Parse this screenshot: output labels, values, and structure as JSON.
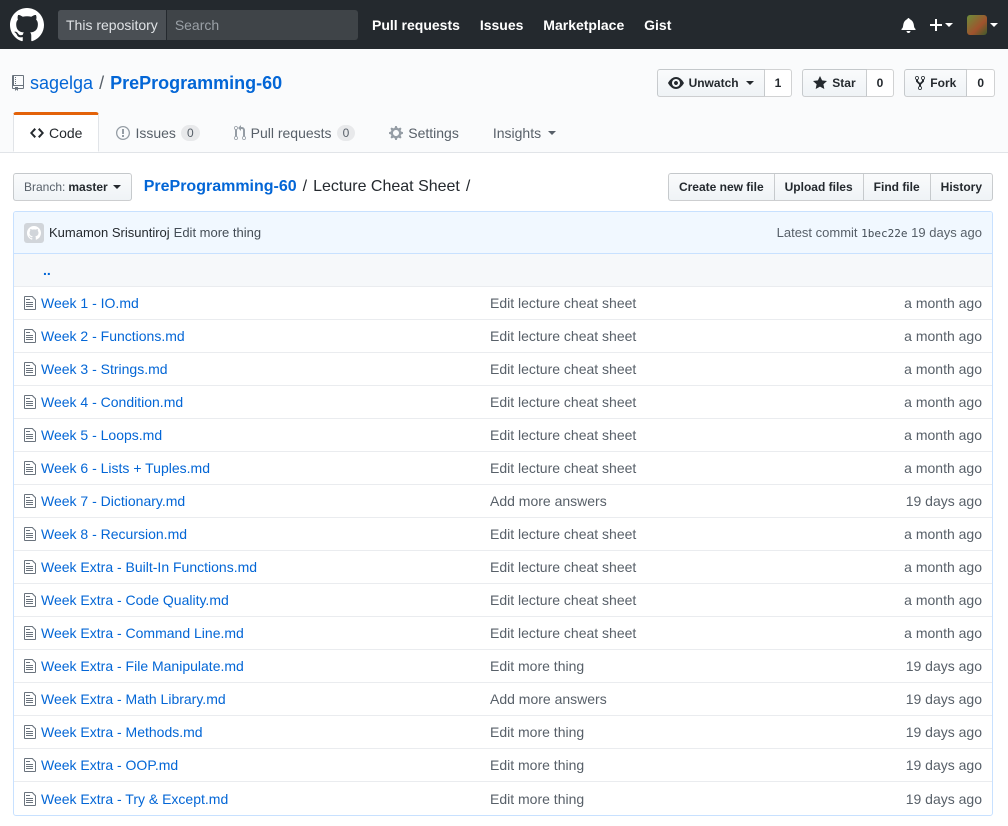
{
  "header": {
    "search_scope": "This repository",
    "search_placeholder": "Search",
    "nav": [
      "Pull requests",
      "Issues",
      "Marketplace",
      "Gist"
    ],
    "icons": [
      "github-logo-icon",
      "bell-icon",
      "plus-icon",
      "avatar"
    ]
  },
  "repo": {
    "owner": "sagelga",
    "separator": "/",
    "name": "PreProgramming-60",
    "watch_label": "Unwatch",
    "watch_count": "1",
    "star_label": "Star",
    "star_count": "0",
    "fork_label": "Fork",
    "fork_count": "0"
  },
  "tabs": [
    {
      "label": "Code",
      "counter": null,
      "icon": "code-icon"
    },
    {
      "label": "Issues",
      "counter": "0",
      "icon": "issue-icon"
    },
    {
      "label": "Pull requests",
      "counter": "0",
      "icon": "pr-icon"
    },
    {
      "label": "Settings",
      "counter": null,
      "icon": "gear-icon"
    },
    {
      "label": "Insights",
      "counter": null,
      "icon": null
    }
  ],
  "file_nav": {
    "branch_prefix": "Branch:",
    "branch": "master",
    "breadcrumb_root": "PreProgramming-60",
    "breadcrumb_sep": "/",
    "breadcrumb_current": "Lecture Cheat Sheet",
    "breadcrumb_trailing": "/",
    "actions": [
      "Create new file",
      "Upload files",
      "Find file",
      "History"
    ]
  },
  "commit": {
    "author": "Kumamon Srisuntiroj",
    "message": "Edit more thing",
    "latest_label": "Latest commit",
    "sha": "1bec22e",
    "age": "19 days ago"
  },
  "up_dir": "..",
  "files": [
    {
      "name": "Week 1 - IO.md",
      "message": "Edit lecture cheat sheet",
      "age": "a month ago"
    },
    {
      "name": "Week 2 - Functions.md",
      "message": "Edit lecture cheat sheet",
      "age": "a month ago"
    },
    {
      "name": "Week 3 - Strings.md",
      "message": "Edit lecture cheat sheet",
      "age": "a month ago"
    },
    {
      "name": "Week 4 - Condition.md",
      "message": "Edit lecture cheat sheet",
      "age": "a month ago"
    },
    {
      "name": "Week 5 - Loops.md",
      "message": "Edit lecture cheat sheet",
      "age": "a month ago"
    },
    {
      "name": "Week 6 - Lists + Tuples.md",
      "message": "Edit lecture cheat sheet",
      "age": "a month ago"
    },
    {
      "name": "Week 7 - Dictionary.md",
      "message": "Add more answers",
      "age": "19 days ago"
    },
    {
      "name": "Week 8 - Recursion.md",
      "message": "Edit lecture cheat sheet",
      "age": "a month ago"
    },
    {
      "name": "Week Extra - Built-In Functions.md",
      "message": "Edit lecture cheat sheet",
      "age": "a month ago"
    },
    {
      "name": "Week Extra - Code Quality.md",
      "message": "Edit lecture cheat sheet",
      "age": "a month ago"
    },
    {
      "name": "Week Extra - Command Line.md",
      "message": "Edit lecture cheat sheet",
      "age": "a month ago"
    },
    {
      "name": "Week Extra - File Manipulate.md",
      "message": "Edit more thing",
      "age": "19 days ago"
    },
    {
      "name": "Week Extra - Math Library.md",
      "message": "Add more answers",
      "age": "19 days ago"
    },
    {
      "name": "Week Extra - Methods.md",
      "message": "Edit more thing",
      "age": "19 days ago"
    },
    {
      "name": "Week Extra - OOP.md",
      "message": "Edit more thing",
      "age": "19 days ago"
    },
    {
      "name": "Week Extra - Try & Except.md",
      "message": "Edit more thing",
      "age": "19 days ago"
    }
  ]
}
